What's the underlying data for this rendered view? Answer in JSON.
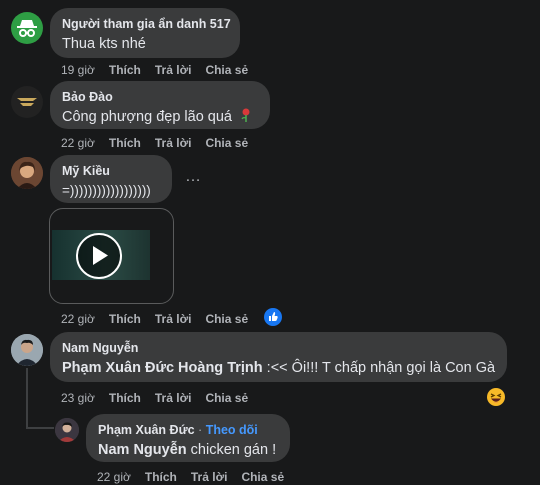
{
  "comments": [
    {
      "author": "Người tham gia ẩn danh 517",
      "text": "Thua kts nhé",
      "time": "19 giờ",
      "like": "Thích",
      "reply": "Trả lời",
      "share": "Chia sẻ"
    },
    {
      "author": "Bảo Đào",
      "text": "Công phượng đẹp lão quá",
      "time": "22 giờ",
      "like": "Thích",
      "reply": "Trả lời",
      "share": "Chia sẻ"
    },
    {
      "author": "Mỹ Kiều",
      "text": "=))))))))))))))))))",
      "more": "…",
      "time": "22 giờ",
      "like": "Thích",
      "reply": "Trả lời",
      "share": "Chia sẻ"
    },
    {
      "author": "Nam Nguyễn",
      "mention": "Phạm Xuân Đức Hoàng Trịnh",
      "text": " :<< Ôi!!! T chấp nhận gọi là Con Gà",
      "time": "23 giờ",
      "like": "Thích",
      "reply": "Trả lời",
      "share": "Chia sẻ"
    },
    {
      "author": "Phạm Xuân Đức",
      "follow": "Theo dõi",
      "separator": " · ",
      "mention": "Nam Nguyễn",
      "text": " chicken gán !",
      "time": "22 giờ",
      "like": "Thích",
      "reply": "Trả lời",
      "share": "Chia sẻ"
    }
  ],
  "colors": {
    "background": "#18191a",
    "bubble": "#3a3b3c",
    "link": "#4599ff",
    "like_reaction": "#1877f2"
  },
  "icons": {
    "anon_avatar": "incognito-icon",
    "video_play": "play-icon",
    "like_reaction": "thumbs-up-icon",
    "haha_reaction": "laughing-emoji-icon"
  }
}
